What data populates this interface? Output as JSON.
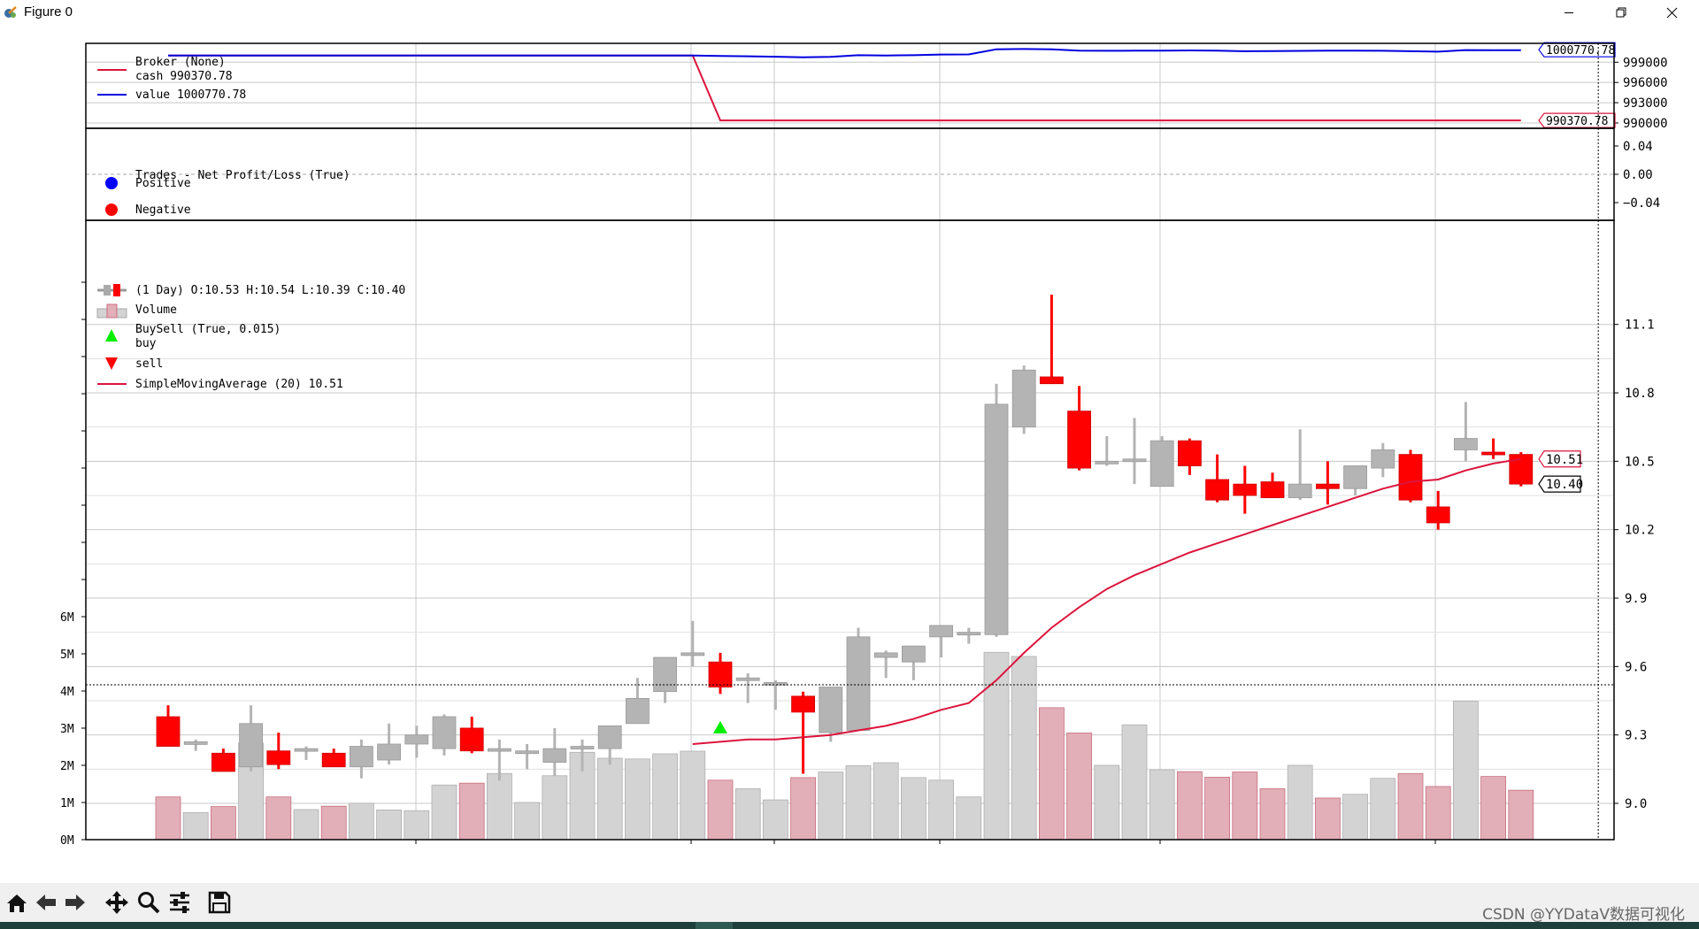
{
  "window": {
    "title": "Figure 0",
    "minimize_icon": "minimize-icon",
    "maximize_icon": "restore-icon",
    "close_icon": "close-icon"
  },
  "toolbar": {
    "buttons": [
      {
        "name": "home-button",
        "icon": "home-icon"
      },
      {
        "name": "back-button",
        "icon": "arrow-left-icon"
      },
      {
        "name": "forward-button",
        "icon": "arrow-right-icon"
      },
      {
        "name": "pan-button",
        "icon": "move-icon"
      },
      {
        "name": "zoom-button",
        "icon": "magnifier-icon"
      },
      {
        "name": "configure-subplots-button",
        "icon": "sliders-icon"
      },
      {
        "name": "save-button",
        "icon": "floppy-disk-icon"
      }
    ]
  },
  "watermark": "CSDN @YYDataV数据可视化",
  "chart_data": [
    {
      "type": "line",
      "title": "",
      "legend": {
        "title": "Broker (None)",
        "entries": [
          "cash 990370.78",
          "value 1000770.78"
        ],
        "placement": "top-left"
      },
      "y_ticks": [
        "990000",
        "993000",
        "996000",
        "999000"
      ],
      "ylim": [
        989600,
        1001400
      ],
      "grid": true,
      "series": [
        {
          "name": "cash",
          "color": "#dc143c",
          "flat_value": 1000000,
          "drop_index": 19,
          "after_value": 990370.78,
          "end_label": "990370.78"
        },
        {
          "name": "value",
          "color": "#0000e0",
          "values": [
            1000000,
            1000000,
            1000000,
            1000000,
            1000000,
            1000000,
            1000000,
            1000000,
            1000000,
            1000000,
            1000000,
            1000000,
            1000000,
            1000000,
            1000000,
            1000000,
            1000000,
            1000000,
            1000000,
            1000000,
            999920,
            999880,
            999820,
            999720,
            999800,
            1000040,
            1000000,
            1000040,
            1000140,
            1000160,
            1000910,
            1000960,
            1000920,
            1000720,
            1000690,
            1000700,
            1000710,
            1000750,
            1000700,
            1000620,
            1000650,
            1000680,
            1000700,
            1000720,
            1000690,
            1000620,
            1000560,
            1000800,
            1000770,
            1000771
          ],
          "end_label": "1000770.78"
        }
      ]
    },
    {
      "type": "scatter",
      "title": "",
      "legend": {
        "title": "Trades - Net Profit/Loss (True)",
        "entries": [
          "Positive",
          "Negative"
        ],
        "colors": [
          "#0000ff",
          "#ff0000"
        ],
        "placement": "top-left"
      },
      "y_ticks": [
        "0.04",
        "0.00",
        "−0.04"
      ],
      "ylim": [
        -0.06,
        0.06
      ],
      "points": []
    },
    {
      "type": "candlestick",
      "title": "",
      "legend": {
        "entries": [
          " (1 Day) O:10.53 H:10.54 L:10.39 C:10.40",
          "Volume",
          "BuySell (True, 0.015)",
          "buy",
          "sell",
          "SimpleMovingAverage (20) 10.51"
        ],
        "placement": "top-left"
      },
      "y_ticks": [
        "9.0",
        "9.3",
        "9.6",
        "9.9",
        "10.2",
        "10.5",
        "10.8",
        "11.1"
      ],
      "ylim": [
        8.85,
        11.4
      ],
      "volume_ticks": [
        "0M",
        "1M",
        "2M",
        "3M",
        "4M",
        "5M",
        "6M"
      ],
      "volume_ylim": [
        0,
        12000000
      ],
      "colors": {
        "up": "#b4b4b4",
        "down": "#ff0000",
        "up_volume": "#d3d3d3",
        "down_volume": "#e2aeb8",
        "sma": "#dc143c",
        "buy": "#00ee00"
      },
      "ohlc": [
        [
          9.38,
          9.43,
          9.27,
          9.25
        ],
        [
          9.27,
          9.28,
          9.23,
          9.27
        ],
        [
          9.22,
          9.24,
          9.15,
          9.14
        ],
        [
          9.16,
          9.43,
          9.14,
          9.35
        ],
        [
          9.23,
          9.31,
          9.15,
          9.17
        ],
        [
          9.24,
          9.25,
          9.19,
          9.24
        ],
        [
          9.22,
          9.24,
          9.17,
          9.16
        ],
        [
          9.16,
          9.28,
          9.11,
          9.25
        ],
        [
          9.19,
          9.35,
          9.17,
          9.26
        ],
        [
          9.26,
          9.34,
          9.2,
          9.3
        ],
        [
          9.24,
          9.39,
          9.21,
          9.38
        ],
        [
          9.33,
          9.38,
          9.22,
          9.23
        ],
        [
          9.24,
          9.28,
          9.1,
          9.24
        ],
        [
          9.22,
          9.26,
          9.15,
          9.23
        ],
        [
          9.18,
          9.33,
          9.12,
          9.24
        ],
        [
          9.24,
          9.28,
          9.14,
          9.25
        ],
        [
          9.24,
          9.32,
          9.17,
          9.34
        ],
        [
          9.35,
          9.55,
          9.35,
          9.46
        ],
        [
          9.49,
          9.63,
          9.44,
          9.64
        ],
        [
          9.66,
          9.8,
          9.6,
          9.66
        ],
        [
          9.62,
          9.66,
          9.48,
          9.51
        ],
        [
          9.55,
          9.57,
          9.44,
          9.55
        ],
        [
          9.53,
          9.54,
          9.41,
          9.53
        ],
        [
          9.47,
          9.49,
          9.13,
          9.4
        ],
        [
          9.31,
          9.43,
          9.27,
          9.51
        ],
        [
          9.32,
          9.77,
          9.32,
          9.73
        ],
        [
          9.64,
          9.67,
          9.55,
          9.66
        ],
        [
          9.62,
          9.68,
          9.54,
          9.69
        ],
        [
          9.73,
          9.74,
          9.64,
          9.78
        ],
        [
          9.74,
          9.77,
          9.7,
          9.75
        ],
        [
          9.74,
          10.84,
          9.73,
          10.75
        ],
        [
          10.65,
          10.92,
          10.62,
          10.9
        ],
        [
          10.87,
          11.23,
          10.85,
          10.84
        ],
        [
          10.72,
          10.83,
          10.46,
          10.47
        ],
        [
          10.5,
          10.61,
          10.48,
          10.5
        ],
        [
          10.51,
          10.69,
          10.4,
          10.51
        ],
        [
          10.39,
          10.61,
          10.39,
          10.59
        ],
        [
          10.59,
          10.6,
          10.44,
          10.48
        ],
        [
          10.42,
          10.53,
          10.32,
          10.33
        ],
        [
          10.4,
          10.48,
          10.27,
          10.35
        ],
        [
          10.41,
          10.45,
          10.34,
          10.34
        ],
        [
          10.34,
          10.64,
          10.33,
          10.4
        ],
        [
          10.4,
          10.5,
          10.31,
          10.38
        ],
        [
          10.38,
          10.47,
          10.35,
          10.48
        ],
        [
          10.47,
          10.58,
          10.43,
          10.55
        ],
        [
          10.53,
          10.55,
          10.32,
          10.33
        ],
        [
          10.3,
          10.37,
          10.2,
          10.23
        ],
        [
          10.55,
          10.76,
          10.5,
          10.6
        ],
        [
          10.54,
          10.6,
          10.51,
          10.53
        ],
        [
          10.53,
          10.54,
          10.39,
          10.4
        ]
      ],
      "volume": [
        1.15,
        0.73,
        0.89,
        2.6,
        1.15,
        0.81,
        0.9,
        0.98,
        0.8,
        0.78,
        1.47,
        1.52,
        1.78,
        1.0,
        1.72,
        2.35,
        2.19,
        2.17,
        2.31,
        2.38,
        1.6,
        1.37,
        1.07,
        1.67,
        1.82,
        1.99,
        2.07,
        1.67,
        1.6,
        1.15,
        5.04,
        4.93,
        3.55,
        2.87,
        2.0,
        3.09,
        1.88,
        1.83,
        1.68,
        1.82,
        1.37,
        2.0,
        1.12,
        1.22,
        1.65,
        1.78,
        1.43,
        3.73,
        1.7,
        1.33
      ],
      "volume_unit": "M",
      "sma": [
        null,
        null,
        null,
        null,
        null,
        null,
        null,
        null,
        null,
        null,
        null,
        null,
        null,
        null,
        null,
        null,
        null,
        null,
        null,
        9.26,
        9.27,
        9.28,
        9.28,
        9.29,
        9.3,
        9.32,
        9.34,
        9.37,
        9.41,
        9.44,
        9.54,
        9.66,
        9.77,
        9.86,
        9.94,
        10.0,
        10.05,
        10.1,
        10.14,
        10.18,
        10.22,
        10.26,
        10.3,
        10.34,
        10.38,
        10.41,
        10.42,
        10.46,
        10.49,
        10.51
      ],
      "buy_markers": [
        {
          "index": 20,
          "price": 9.33
        }
      ],
      "end_labels": [
        "10.51",
        "10.40"
      ],
      "cursor": {
        "x_index": 51.8,
        "price": 9.52
      }
    }
  ]
}
